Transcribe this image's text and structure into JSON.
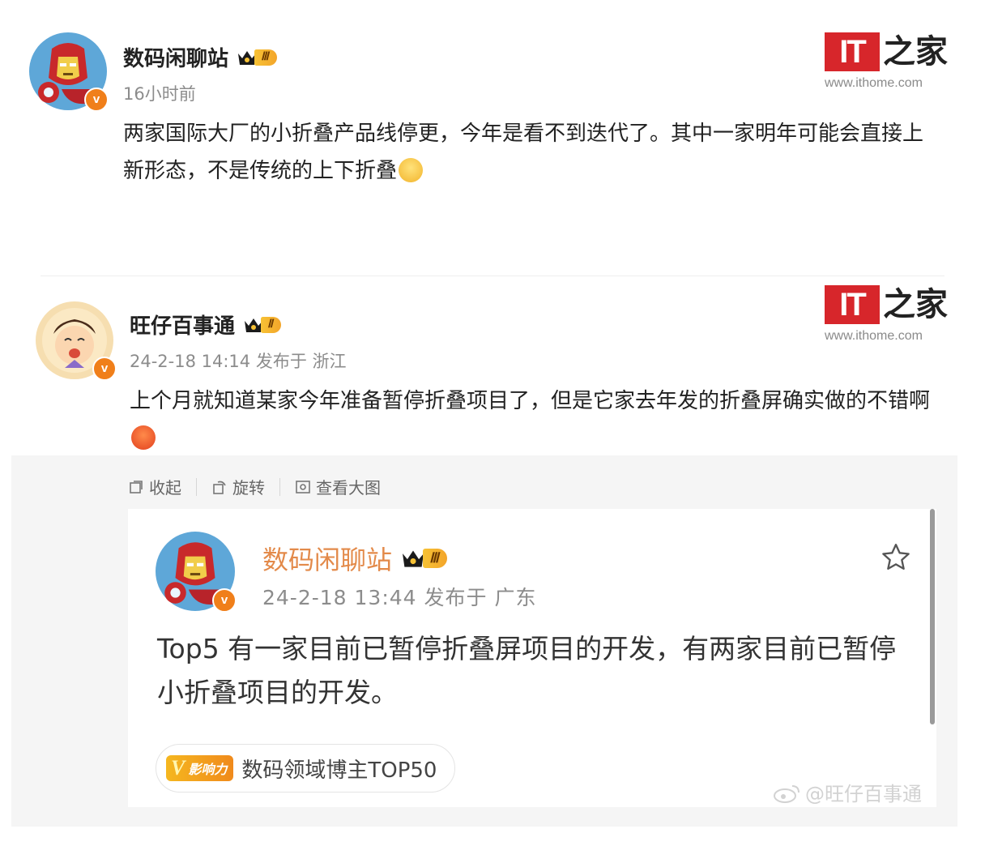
{
  "post1": {
    "username": "数码闲聊站",
    "rank": "Ⅲ",
    "time": "16小时前",
    "text": "两家国际大厂的小折叠产品线停更，今年是看不到迭代了。其中一家明年可能会直接上新形态，不是传统的上下折叠",
    "emoji": "smile-emoji"
  },
  "post2": {
    "username": "旺仔百事通",
    "rank": "Ⅱ",
    "meta": "24-2-18 14:14 发布于 浙江",
    "text": "上个月就知道某家今年准备暂停折叠项目了，但是它家去年发的折叠屏确实做的不错啊",
    "emoji": "angry-emoji"
  },
  "logo": {
    "brand_it": "IT",
    "brand_zh": "之家",
    "url": "www.ithome.com"
  },
  "toolbar": {
    "collapse": "收起",
    "rotate": "旋转",
    "view_large": "查看大图"
  },
  "embed": {
    "username": "数码闲聊站",
    "rank": "Ⅲ",
    "meta": "24-2-18 13:44  发布于 广东",
    "text": "Top5 有一家目前已暂停折叠屏项目的开发，有两家目前已暂停小折叠项目的开发。",
    "badge_label": "影响力",
    "badge_text": "数码领域博主TOP50",
    "watermark": "@旺仔百事通"
  },
  "colors": {
    "accent": "#f07f1a",
    "brand_red": "#d7262b",
    "embed_name": "#e38a4a"
  }
}
